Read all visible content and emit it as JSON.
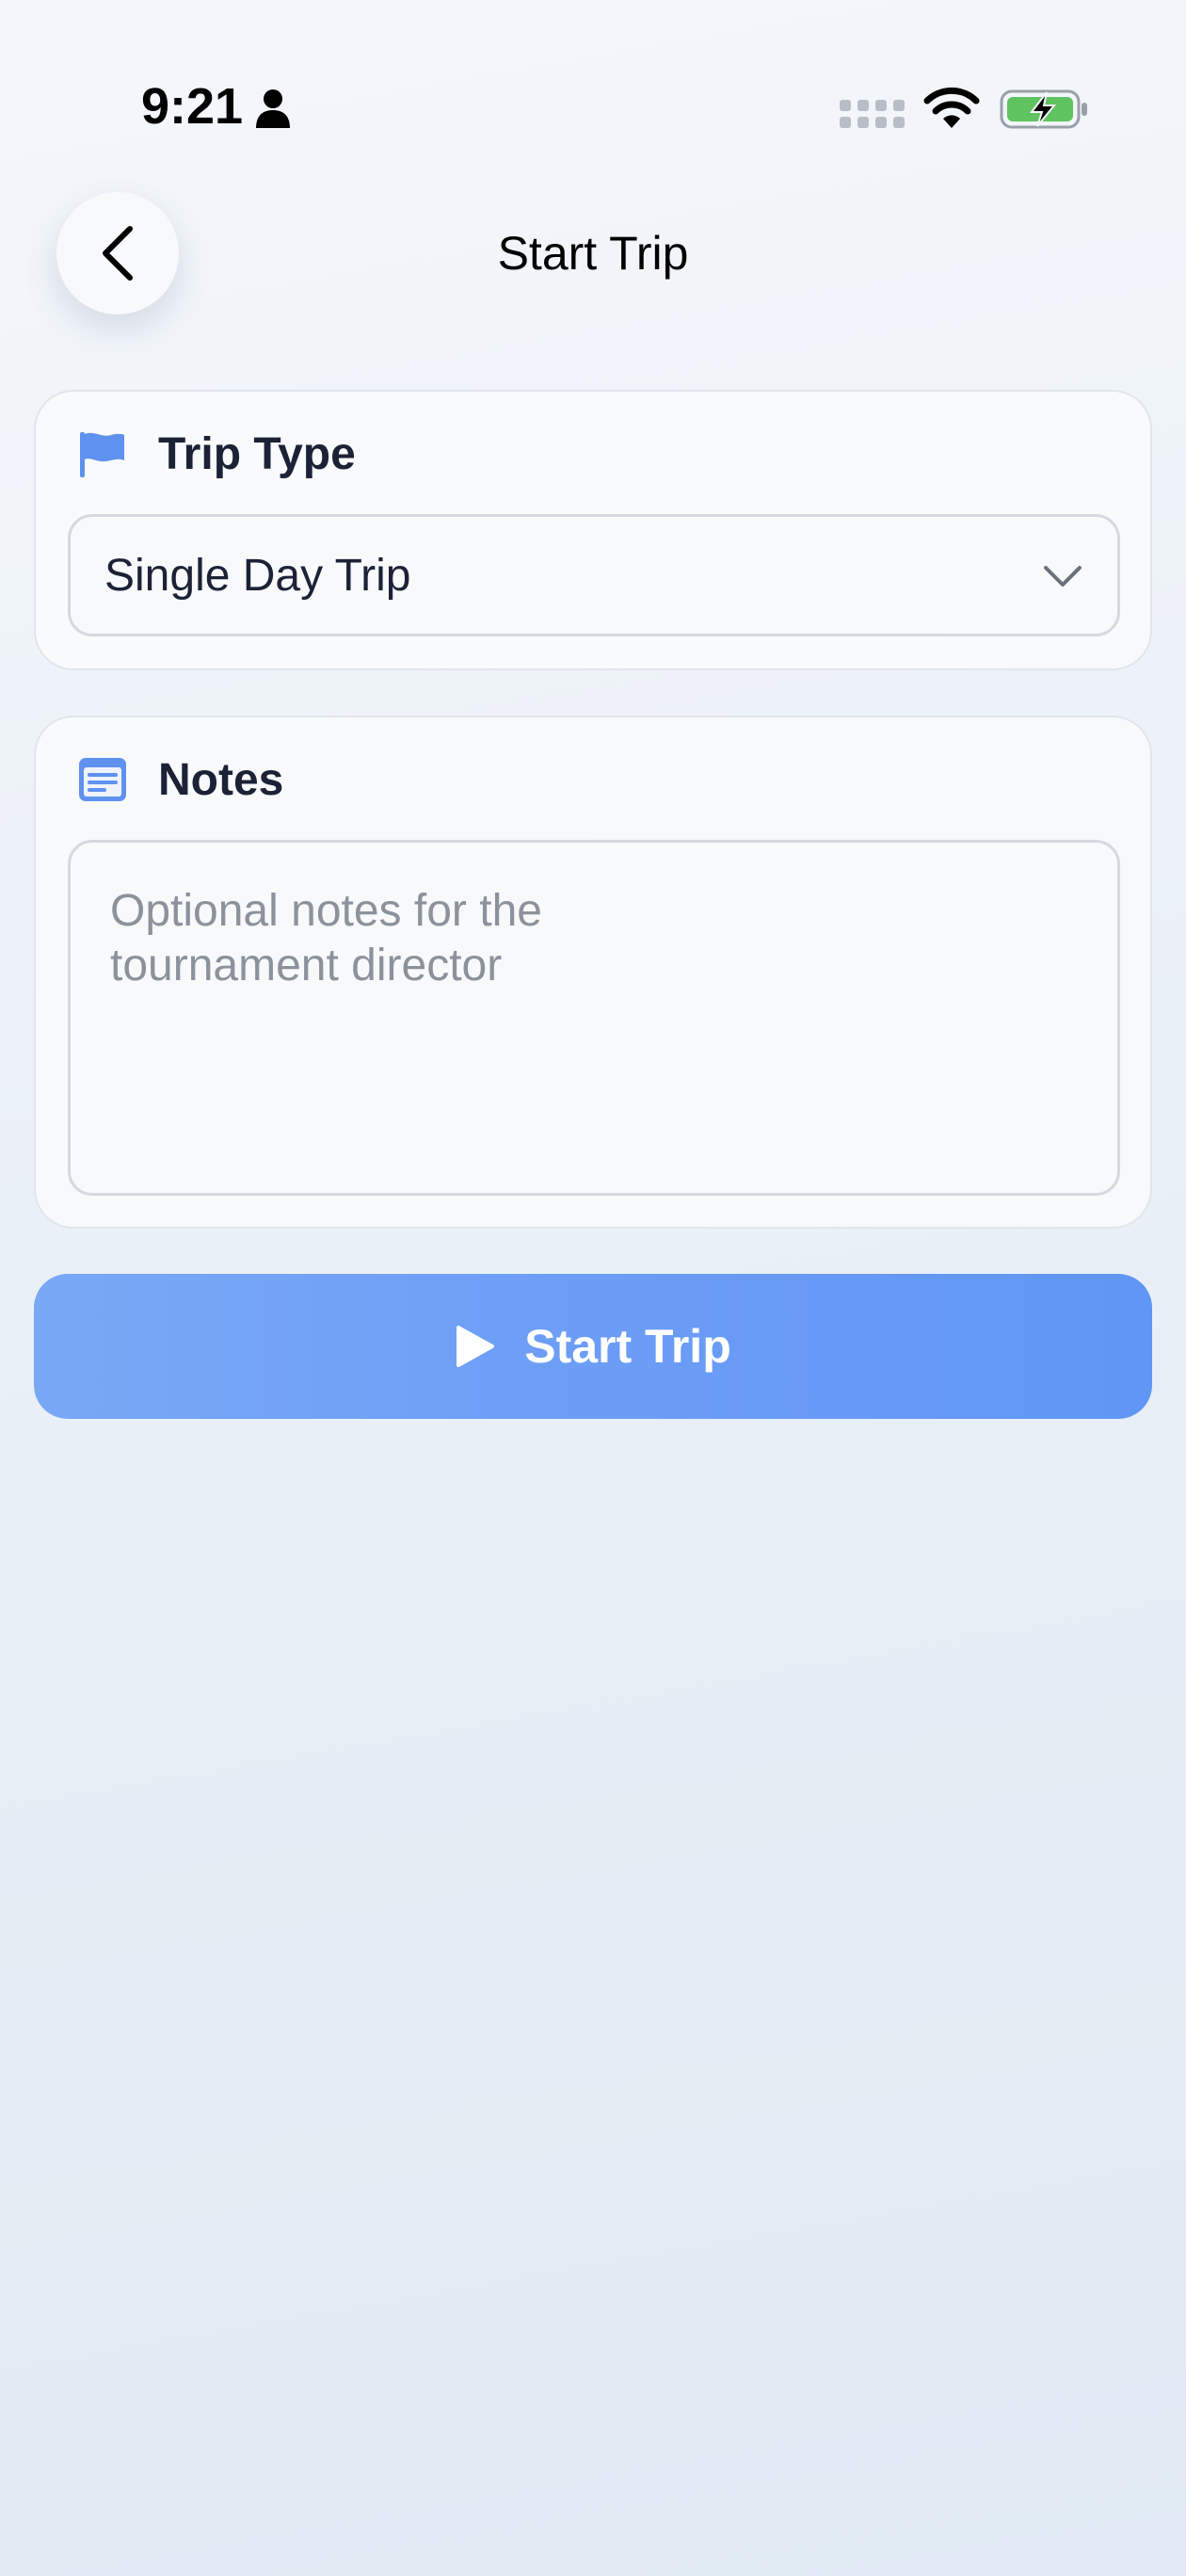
{
  "status_bar": {
    "time": "9:21",
    "icons": [
      "person-icon",
      "cellular-signal-icon",
      "wifi-icon",
      "battery-charging-icon"
    ],
    "battery_color": "#5fc45f"
  },
  "header": {
    "title": "Start Trip",
    "back_icon": "chevron-left-icon"
  },
  "trip_type": {
    "label": "Trip Type",
    "icon": "flag-icon",
    "selected_value": "Single Day Trip",
    "dropdown_icon": "chevron-down-icon"
  },
  "notes": {
    "label": "Notes",
    "icon": "notes-icon",
    "value": "",
    "placeholder": "Optional notes for the tournament director"
  },
  "start_button": {
    "label": "Start Trip",
    "icon": "play-icon"
  },
  "colors": {
    "accent": "#6c9df6",
    "icon_blue": "#5f92ef",
    "text_dark": "#1c2236",
    "placeholder": "#8c929c"
  }
}
